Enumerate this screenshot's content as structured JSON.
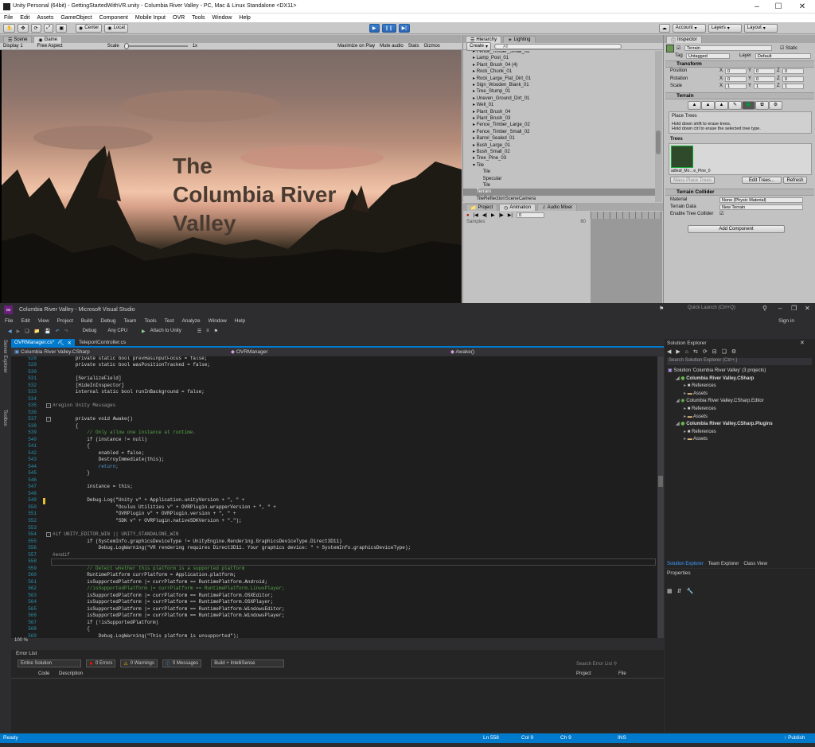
{
  "unity": {
    "title": "Unity Personal (64bit) - GettingStartedWithVR.unity - Columbia River Valley - PC, Mac & Linux Standalone <DX11>",
    "menu": [
      "File",
      "Edit",
      "Assets",
      "GameObject",
      "Component",
      "Mobile Input",
      "OVR",
      "Tools",
      "Window",
      "Help"
    ],
    "toolbar": {
      "center": "Center",
      "local": "Local",
      "account": "Account",
      "layers": "Layers",
      "layout": "Layout"
    },
    "scene_tabs": [
      "Scene",
      "Game"
    ],
    "game_bar": {
      "display": "Display 1",
      "aspect": "Free Aspect",
      "scale_label": "Scale",
      "scale_value": "1x",
      "max": "Maximize on Play",
      "mute": "Mute audio",
      "stats": "Stats",
      "gizmos": "Gizmos"
    },
    "game_title": "The\nColumbia River\nValley",
    "hierarchy": {
      "tabs": [
        "Hierarchy",
        "Lighting"
      ],
      "create": "Create",
      "search": "All",
      "items": [
        {
          "label": "Fence_Timber_Small_02",
          "indent": 1,
          "arrow": true
        },
        {
          "label": "Lamp_Post_01",
          "indent": 1,
          "arrow": true
        },
        {
          "label": "Plant_Brush_04 (4)",
          "indent": 1,
          "arrow": true
        },
        {
          "label": "Rock_Chunk_01",
          "indent": 1,
          "arrow": true
        },
        {
          "label": "Rock_Large_Flat_Dirt_01",
          "indent": 1,
          "arrow": true
        },
        {
          "label": "Sign_Wooden_Blank_01",
          "indent": 1,
          "arrow": true
        },
        {
          "label": "Tree_Stump_01",
          "indent": 1,
          "arrow": true
        },
        {
          "label": "Uneven_Ground_Dirt_01",
          "indent": 1,
          "arrow": true
        },
        {
          "label": "Well_01",
          "indent": 1,
          "arrow": true
        },
        {
          "label": "Plant_Brush_04",
          "indent": 1,
          "arrow": true
        },
        {
          "label": "Plant_Brush_03",
          "indent": 1,
          "arrow": true
        },
        {
          "label": "Fence_Timber_Large_02",
          "indent": 1,
          "arrow": true
        },
        {
          "label": "Fence_Timber_Small_02",
          "indent": 1,
          "arrow": true
        },
        {
          "label": "Barrel_Sealed_01",
          "indent": 1,
          "arrow": true
        },
        {
          "label": "Bush_Large_01",
          "indent": 1,
          "arrow": true
        },
        {
          "label": "Bush_Small_02",
          "indent": 1,
          "arrow": true
        },
        {
          "label": "Tree_Pine_03",
          "indent": 1,
          "arrow": true
        },
        {
          "label": "Tile",
          "indent": 1,
          "arrow": true,
          "open": true
        },
        {
          "label": "Tile",
          "indent": 2,
          "arrow": false
        },
        {
          "label": "Specular",
          "indent": 2,
          "arrow": false
        },
        {
          "label": "Tile",
          "indent": 2,
          "arrow": false
        },
        {
          "label": "Terrain",
          "indent": 1,
          "arrow": false,
          "selected": true
        },
        {
          "label": "TileReflectionSceneCamera",
          "indent": 1,
          "arrow": false
        }
      ]
    },
    "project_tabs": [
      "Project",
      "Animation",
      "Audio Mixer"
    ],
    "animation": {
      "frame": "0",
      "samples_label": "Samples",
      "samples": "60"
    },
    "inspector": {
      "tab": "Inspector",
      "object_name": "Terrain",
      "static": "Static",
      "tag_label": "Tag",
      "tag": "Untagged",
      "layer_label": "Layer",
      "layer": "Default",
      "transform": {
        "title": "Transform",
        "rows": [
          {
            "label": "Position",
            "x": "0",
            "y": "0",
            "z": "0"
          },
          {
            "label": "Rotation",
            "x": "0",
            "y": "0",
            "z": "0"
          },
          {
            "label": "Scale",
            "x": "1",
            "y": "1",
            "z": "1"
          }
        ]
      },
      "terrain": {
        "title": "Terrain",
        "tool": "Place Trees",
        "hint1": "Hold down shift to erase trees.",
        "hint2": "Hold down ctrl to erase the selected tree type.",
        "trees_label": "Trees",
        "tree_name": "adleaf_Mo…e_Pine_0",
        "mass": "Mass Place Trees",
        "edit": "Edit Trees...",
        "refresh": "Refresh"
      },
      "collider": {
        "title": "Terrain Collider",
        "material_label": "Material",
        "material": "None (Physic Material)",
        "data_label": "Terrain Data",
        "data": "New Terrain",
        "enable": "Enable Tree Collider"
      },
      "add_component": "Add Component"
    }
  },
  "vs": {
    "title": "Columbia River Valley - Microsoft Visual Studio",
    "quick_launch": "Quick Launch (Ctrl+Q)",
    "sign_in": "Sign in",
    "menu": [
      "File",
      "Edit",
      "View",
      "Project",
      "Build",
      "Debug",
      "Team",
      "Tools",
      "Test",
      "Analyze",
      "Window",
      "Help"
    ],
    "toolbar": {
      "config": "Debug",
      "platform": "Any CPU",
      "attach": "Attach to Unity"
    },
    "side_tabs": [
      "Server Explorer",
      "Toolbox"
    ],
    "doc_tabs": [
      "OVRManager.cs*",
      "TeleportController.cs"
    ],
    "nav": {
      "project": "Columbia River Valley.CSharp",
      "class": "OVRManager",
      "member": "Awake()"
    },
    "zoom": "100 %",
    "code": [
      {
        "n": "528",
        "t": "        private static bool prevHasInputFocus = false;",
        "c": ""
      },
      {
        "n": "529",
        "t": "        private static bool wasPositionTracked = false;",
        "c": ""
      },
      {
        "n": "530",
        "t": "",
        "c": ""
      },
      {
        "n": "531",
        "t": "        [SerializeField]",
        "c": ""
      },
      {
        "n": "532",
        "t": "        [HideInInspector]",
        "c": ""
      },
      {
        "n": "533",
        "t": "        internal static bool runInBackground = false;",
        "c": ""
      },
      {
        "n": "534",
        "t": "",
        "c": ""
      },
      {
        "n": "535",
        "t": "#region Unity Messages",
        "c": "pp"
      },
      {
        "n": "536",
        "t": "",
        "c": ""
      },
      {
        "n": "537",
        "t": "        private void Awake()",
        "c": ""
      },
      {
        "n": "538",
        "t": "        {",
        "c": ""
      },
      {
        "n": "539",
        "t": "            // Only allow one instance at runtime.",
        "c": "cm"
      },
      {
        "n": "540",
        "t": "            if (instance != null)",
        "c": ""
      },
      {
        "n": "541",
        "t": "            {",
        "c": ""
      },
      {
        "n": "542",
        "t": "                enabled = false;",
        "c": ""
      },
      {
        "n": "543",
        "t": "                DestroyImmediate(this);",
        "c": ""
      },
      {
        "n": "544",
        "t": "                return;",
        "c": "kw"
      },
      {
        "n": "545",
        "t": "            }",
        "c": ""
      },
      {
        "n": "546",
        "t": "",
        "c": ""
      },
      {
        "n": "547",
        "t": "            instance = this;",
        "c": ""
      },
      {
        "n": "548",
        "t": "",
        "c": ""
      },
      {
        "n": "549",
        "t": "            Debug.Log(\"Unity v\" + Application.unityVersion + \", \" +",
        "c": ""
      },
      {
        "n": "550",
        "t": "                      \"Oculus Utilities v\" + OVRPlugin.wrapperVersion + \", \" +",
        "c": ""
      },
      {
        "n": "551",
        "t": "                      \"OVRPlugin v\" + OVRPlugin.version + \", \" +",
        "c": ""
      },
      {
        "n": "552",
        "t": "                      \"SDK v\" + OVRPlugin.nativeSDKVersion + \".\");",
        "c": ""
      },
      {
        "n": "553",
        "t": "",
        "c": ""
      },
      {
        "n": "554",
        "t": "#if UNITY_EDITOR_WIN || UNITY_STANDALONE_WIN",
        "c": "pp"
      },
      {
        "n": "555",
        "t": "            if (SystemInfo.graphicsDeviceType != UnityEngine.Rendering.GraphicsDeviceType.Direct3D11)",
        "c": ""
      },
      {
        "n": "556",
        "t": "                Debug.LogWarning(\"VR rendering requires Direct3D11. Your graphics device: \" + SystemInfo.graphicsDeviceType);",
        "c": ""
      },
      {
        "n": "557",
        "t": "#endif",
        "c": "pp"
      },
      {
        "n": "558",
        "t": "",
        "c": ""
      },
      {
        "n": "559",
        "t": "            // Detect whether this platform is a supported platform",
        "c": "cm"
      },
      {
        "n": "560",
        "t": "            RuntimePlatform currPlatform = Application.platform;",
        "c": ""
      },
      {
        "n": "561",
        "t": "            isSupportedPlatform |= currPlatform == RuntimePlatform.Android;",
        "c": ""
      },
      {
        "n": "562",
        "t": "            //isSupportedPlatform |= currPlatform == RuntimePlatform.LinuxPlayer;",
        "c": "cm"
      },
      {
        "n": "563",
        "t": "            isSupportedPlatform |= currPlatform == RuntimePlatform.OSXEditor;",
        "c": ""
      },
      {
        "n": "564",
        "t": "            isSupportedPlatform |= currPlatform == RuntimePlatform.OSXPlayer;",
        "c": ""
      },
      {
        "n": "565",
        "t": "            isSupportedPlatform |= currPlatform == RuntimePlatform.WindowsEditor;",
        "c": ""
      },
      {
        "n": "566",
        "t": "            isSupportedPlatform |= currPlatform == RuntimePlatform.WindowsPlayer;",
        "c": ""
      },
      {
        "n": "567",
        "t": "            if (!isSupportedPlatform)",
        "c": ""
      },
      {
        "n": "568",
        "t": "            {",
        "c": ""
      },
      {
        "n": "569",
        "t": "                Debug.LogWarning(\"This platform is unsupported\");",
        "c": ""
      }
    ],
    "error_list": {
      "title": "Error List",
      "scope": "Entire Solution",
      "errors": "0 Errors",
      "warnings": "0 Warnings",
      "messages": "0 Messages",
      "build": "Build + IntelliSense",
      "search": "Search Error List",
      "columns": [
        "Code",
        "Description",
        "Project",
        "File"
      ]
    },
    "solution_explorer": {
      "title": "Solution Explorer",
      "search": "Search Solution Explorer (Ctrl+;)",
      "items": [
        {
          "label": "Solution 'Columbia River Valley' (3 projects)",
          "indent": 0,
          "bold": false
        },
        {
          "label": "Columbia River Valley.CSharp",
          "indent": 1,
          "bold": true
        },
        {
          "label": "References",
          "indent": 2,
          "bold": false
        },
        {
          "label": "Assets",
          "indent": 2,
          "bold": false
        },
        {
          "label": "Columbia River Valley.CSharp.Editor",
          "indent": 1,
          "bold": false
        },
        {
          "label": "References",
          "indent": 2,
          "bold": false
        },
        {
          "label": "Assets",
          "indent": 2,
          "bold": false
        },
        {
          "label": "Columbia River Valley.CSharp.Plugins",
          "indent": 1,
          "bold": true
        },
        {
          "label": "References",
          "indent": 2,
          "bold": false
        },
        {
          "label": "Assets",
          "indent": 2,
          "bold": false
        }
      ],
      "bottom_tabs": [
        "Solution Explorer",
        "Team Explorer",
        "Class View"
      ]
    },
    "properties": {
      "title": "Properties"
    },
    "status": {
      "ready": "Ready",
      "ln": "Ln 558",
      "col": "Col 9",
      "ch": "Ch 9",
      "ins": "INS",
      "publish": "Publish"
    }
  }
}
